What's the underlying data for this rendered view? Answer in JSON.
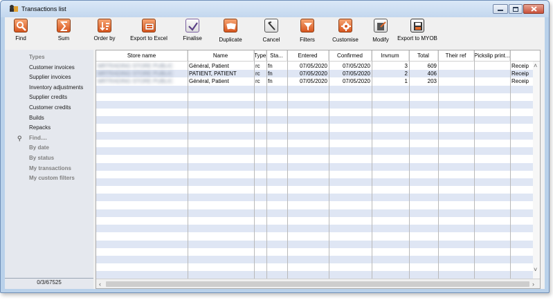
{
  "window": {
    "title": "Transactions list"
  },
  "toolbar": [
    {
      "label": "Find",
      "icon": "search-icon"
    },
    {
      "label": "Sum",
      "icon": "sigma-icon"
    },
    {
      "label": "Order by",
      "icon": "sort-icon"
    },
    {
      "label": "Export to Excel",
      "icon": "export-excel-icon"
    },
    {
      "label": "Finalise",
      "icon": "checkmark-icon"
    },
    {
      "label": "Duplicate",
      "icon": "duplicate-icon"
    },
    {
      "label": "Cancel",
      "icon": "cancel-icon"
    },
    {
      "label": "Filters",
      "icon": "filter-icon"
    },
    {
      "label": "Customise",
      "icon": "gear-icon"
    },
    {
      "label": "Modify",
      "icon": "edit-icon"
    },
    {
      "label": "Export to MYOB",
      "icon": "save-icon"
    }
  ],
  "sidebar": {
    "types_label": "Types",
    "types": [
      "Customer invoices",
      "Supplier invoices",
      "Inventory adjustments",
      "Supplier credits",
      "Customer credits",
      "Builds",
      "Repacks"
    ],
    "filters": [
      "Find....",
      "By date",
      "By status",
      "My transactions",
      "My custom filters"
    ],
    "footer": "0/3/67525"
  },
  "table": {
    "columns": [
      "Store name",
      "Name",
      "Type",
      "Sta...",
      "Entered",
      "Confirmed",
      "Invnum",
      "Total",
      "Their ref",
      "Pickslip print..."
    ],
    "rows": [
      {
        "store": "MRTRADING STORE PUBLIC",
        "name": "Général, Patient",
        "type": "rc",
        "status": "fn",
        "entered": "07/05/2020",
        "confirmed": "07/05/2020",
        "invnum": "3",
        "total": "609",
        "their_ref": "",
        "pickslip": "",
        "extra": "Receip"
      },
      {
        "store": "MRTRADING STORE PUBLIC",
        "name": "PATIENT, PATIENT",
        "type": "rc",
        "status": "fn",
        "entered": "07/05/2020",
        "confirmed": "07/05/2020",
        "invnum": "2",
        "total": "406",
        "their_ref": "",
        "pickslip": "",
        "extra": "Receip"
      },
      {
        "store": "MRTRADING STORE PUBLIC",
        "name": "Général, Patient",
        "type": "rc",
        "status": "fn",
        "entered": "07/05/2020",
        "confirmed": "07/05/2020",
        "invnum": "1",
        "total": "203",
        "their_ref": "",
        "pickslip": "",
        "extra": "Receip"
      }
    ]
  },
  "colors": {
    "accent_icon": "#e06a2c",
    "row_alt": "#dfe6f4",
    "sidebar_bg": "#e5e8ee"
  }
}
